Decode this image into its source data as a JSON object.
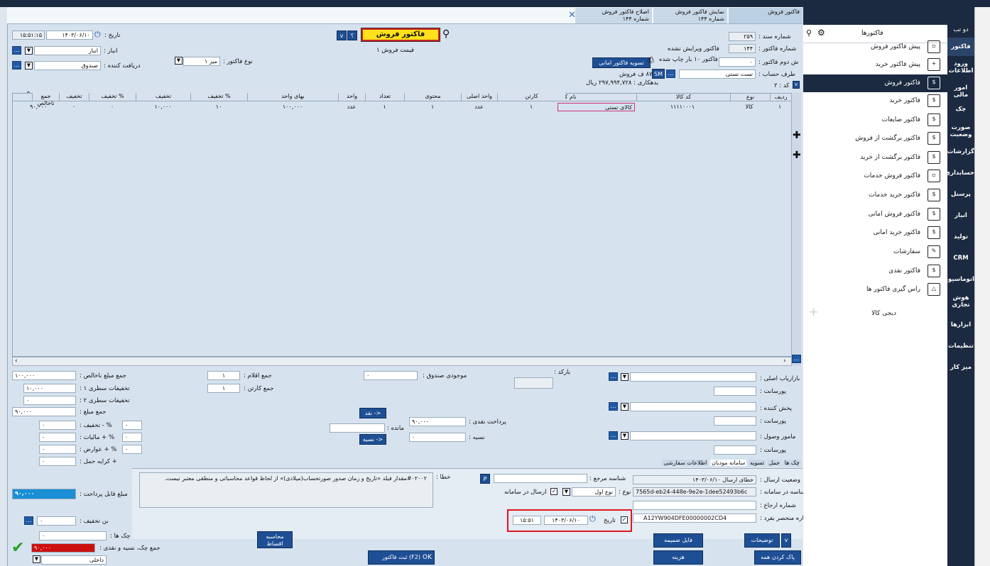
{
  "tabs": [
    {
      "title": "فاکتور فروش",
      "sub": ""
    },
    {
      "title": "نمایش فاکتور فروش",
      "sub": "شماره ۱۴۴"
    },
    {
      "title": "اصلاح فاکتور فروش",
      "sub": "شماره ۱۴۴"
    }
  ],
  "header": {
    "title_button": "فاکتور فروش",
    "doc_no_label": "شماره سند :",
    "doc_no": "۲۵۹",
    "invoice_no_label": "شماره فاکتور :",
    "invoice_no": "۱۴۴",
    "invoice_status": "فاکتور ویرایش نشده",
    "second_no_label": "ش دوم فاکتور :",
    "second_no": "۰",
    "printed_text": "فاکتور ۱۰ بار چاپ شده",
    "party_label": "طرف حساب :",
    "party": "تست تستی",
    "sm": "SM",
    "sales_label": "۸۷ ف فروش",
    "debt_text": "بدهکاری : ۲۹۷,۹۹۴,۷۲۸ ریال",
    "code_label": "کد : ۲",
    "date_label": "تاریخ :",
    "date": "۱۴۰۳/۰۶/۱۰",
    "time": "۱۵:۵۱:۱۵",
    "warehouse_label": "انبار :",
    "warehouse": "انبار",
    "receiver_label": "دریافت کننده :",
    "receiver": "صندوق",
    "invoice_type_label": "نوع فاکتور :",
    "invoice_type": "میز ۱",
    "price_label": "قیمت فروش ۱",
    "settle_button": "تسویه فاکتور امانی",
    "nav_a": "v",
    "nav_b": "؟"
  },
  "grid": {
    "headers": [
      "ردیف",
      "نوع",
      "کد کالا",
      "نام کالا",
      "کارتن",
      "واحد اصلی",
      "محتوی",
      "تعداد",
      "واحد",
      "بهای واحد",
      "% تخفیف",
      "تخفیف",
      "% تخفیف",
      "تخفیف",
      "جمع ناخالص"
    ],
    "row": [
      "۱",
      "کالا",
      "۱۱۱۱۰۰۰۱",
      "کالای تستی",
      "۱",
      "عدد",
      "۱",
      "۱",
      "عدد",
      "۱۰۰,۰۰۰",
      "۱۰",
      "۱۰,۰۰۰",
      "۰",
      "۰",
      "۹۰,۰۰۰"
    ]
  },
  "totals": {
    "gross_label": "جمع مبلغ ناخالص :",
    "gross": "۱۰۰,۰۰۰",
    "line_disc1_label": "تخفیفات سطری ۱ :",
    "line_disc1": "۱۰,۰۰۰",
    "line_disc2_label": "تخفیفات سطری ۲ :",
    "line_disc2": "۰",
    "sum_label": "جمع مبلغ :",
    "sum": "۹۰,۰۰۰",
    "disc_label": "% - تخفیف :",
    "disc": "۰",
    "disc_pct": "۰",
    "tax_label": "% + مالیات :",
    "tax": "۰",
    "tax_pct": "۰",
    "duty_label": "% + عوارض :",
    "duty": "۰",
    "duty_pct": "۰",
    "freight_label": "+ کرایه حمل :",
    "freight": "۰",
    "payable_label": "مبلغ قابل پرداخت :",
    "payable": "۹۰,۰۰۰",
    "no_disc_label": "بن تخفیف :",
    "no_disc": "۰",
    "cheques_label": "جمع چک ها :",
    "cheques": "۰",
    "cheque_cash_label": "جمع چک، نسیه و نقدی :",
    "cheque_cash": "۹۰,۰۰۰",
    "internal": "داخلی",
    "items_label": "جمع اقلام :",
    "items": "۱",
    "cartons_label": "جمع کارتن :",
    "cartons": "۱",
    "cashbox_label": "موجودی صندوق :",
    "cashbox": "۰",
    "barcode_label": "بارکد :"
  },
  "payment": {
    "cash_label": "پرداخت نقدی :",
    "cash": "۹۰,۰۰۰",
    "credit_label": "نسیه :",
    "credit": "۰",
    "remain_label": "مانده :",
    "cash_btn": "<- نقد",
    "credit_btn": "<- نسیه"
  },
  "people": {
    "marketer_label": "بازاریاب اصلی :",
    "commission_label": "پورسانت :",
    "distributor_label": "پخش کننده :",
    "collector_label": "مامور وصول :"
  },
  "subtabs": [
    "چک ها",
    "حمل",
    "تسویه",
    "سامانه مودیان",
    "اطلاعات سفارشی"
  ],
  "moadian": {
    "status_label": "وضعیت ارسال :",
    "status": "خطای ارسال ۱۴۰۳/۰۶/۱۰",
    "tax_id_label": "شناسه در سامانه :",
    "tax_id": "7565d-eb24-448e-9e2e-1dee52493b6c",
    "ref_label": "شماره ارجاع :",
    "unique_label": "شماره منحصر بفرد :",
    "unique": "A12YW904DFE00000002CD4",
    "ref_id_label": "شناسه مرجع :",
    "p": "P",
    "type_label": "نوع :",
    "type": "نوع اول",
    "send_label": "ارسال در سامانه",
    "date_label": "تاریخ",
    "date": "۱۴۰۳/۰۶/۱۰",
    "time": "۱۵:۵۱",
    "error_label": "خطا :",
    "error": "#۰۲۰۰۲مقدار فیلد «تاریخ و زمان صدور صورتحساب(میلادی)» از لحاظ قواعد محاسباتی و منطقی معتبر نیست."
  },
  "buttons": {
    "calc_installments": "محاسبه اقساط",
    "register": "(F2) ثبت فاکتور",
    "ok": "OK",
    "attachment": "فایل ضمیمه",
    "cost": "هزینه",
    "notes": "توضیحات",
    "clear_all": "پاک کردن همه",
    "v": "v"
  },
  "sidebar": {
    "top_label": "دو تب",
    "title": "فاکتورها",
    "items": [
      "پیش فاکتور فروش",
      "پیش فاکتور خرید",
      "فاکتور فروش",
      "فاکتور خرید",
      "فاکتور ضایعات",
      "فاکتور برگشت از فروش",
      "فاکتور برگشت از خرید",
      "فاکتور فروش خدمات",
      "فاکتور خرید خدمات",
      "فاکتور فروش امانی",
      "فاکتور خرید امانی",
      "سفارشات",
      "فاکتور نقدی",
      "راس گیری فاکتور ها",
      "دیجی کالا"
    ],
    "categories": [
      "فاکتور",
      "ورود اطلاعات",
      "امور مالی",
      "چک",
      "صورت وضعیت",
      "گزارشات",
      "حسابداری",
      "پرسنل",
      "انبار",
      "تولید",
      "CRM",
      "اتوماسیون",
      "هوش تجاری",
      "ابزارها",
      "تنظیمات",
      "میز کار"
    ]
  }
}
